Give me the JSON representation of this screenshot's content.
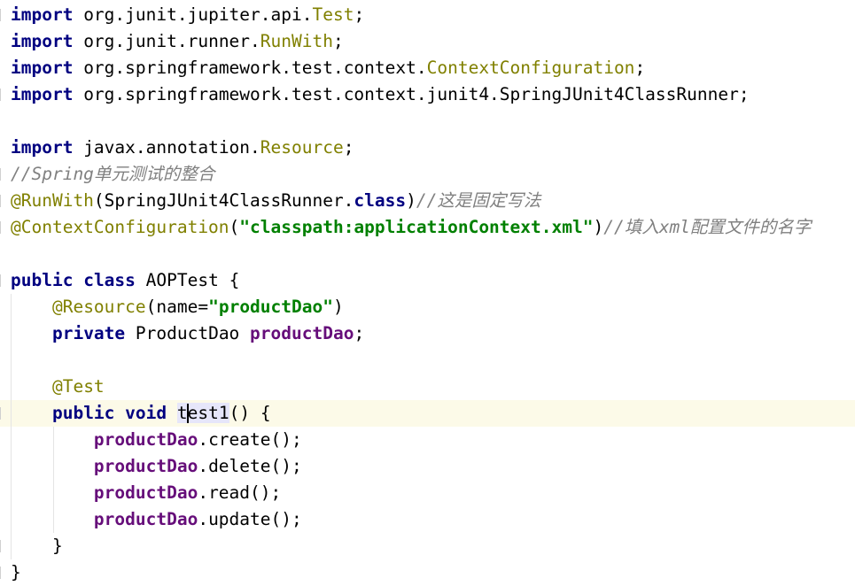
{
  "editor": {
    "lines": [
      [
        {
          "t": "import",
          "c": "kw"
        },
        {
          "t": " org.junit.jupiter.api.",
          "c": "plain"
        },
        {
          "t": "Test",
          "c": "cls-ref"
        },
        {
          "t": ";",
          "c": "plain"
        }
      ],
      [
        {
          "t": "import",
          "c": "kw"
        },
        {
          "t": " org.junit.runner.",
          "c": "plain"
        },
        {
          "t": "RunWith",
          "c": "cls-ref"
        },
        {
          "t": ";",
          "c": "plain"
        }
      ],
      [
        {
          "t": "import",
          "c": "kw"
        },
        {
          "t": " org.springframework.test.context.",
          "c": "plain"
        },
        {
          "t": "ContextConfiguration",
          "c": "cls-ref"
        },
        {
          "t": ";",
          "c": "plain"
        }
      ],
      [
        {
          "t": "import",
          "c": "kw"
        },
        {
          "t": " org.springframework.test.context.junit4.SpringJUnit4ClassRunner;",
          "c": "plain"
        }
      ],
      [],
      [
        {
          "t": "import",
          "c": "kw"
        },
        {
          "t": " javax.annotation.",
          "c": "plain"
        },
        {
          "t": "Resource",
          "c": "cls-ref"
        },
        {
          "t": ";",
          "c": "plain"
        }
      ],
      [
        {
          "t": "//Spring单元测试的整合",
          "c": "cmt"
        }
      ],
      [
        {
          "t": "@RunWith",
          "c": "ann"
        },
        {
          "t": "(SpringJUnit4ClassRunner.",
          "c": "plain"
        },
        {
          "t": "class",
          "c": "kw"
        },
        {
          "t": ")",
          "c": "plain"
        },
        {
          "t": "//这是固定写法",
          "c": "cmt"
        }
      ],
      [
        {
          "t": "@ContextConfiguration",
          "c": "ann"
        },
        {
          "t": "(",
          "c": "plain"
        },
        {
          "t": "\"classpath:applicationContext.xml\"",
          "c": "str"
        },
        {
          "t": ")",
          "c": "plain"
        },
        {
          "t": "//填入xml配置文件的名字",
          "c": "cmt"
        }
      ],
      [],
      [
        {
          "t": "public",
          "c": "kw"
        },
        {
          "t": " ",
          "c": "plain"
        },
        {
          "t": "class",
          "c": "kw"
        },
        {
          "t": " AOPTest {",
          "c": "plain"
        }
      ],
      [
        {
          "t": "    ",
          "c": "plain"
        },
        {
          "t": "@Resource",
          "c": "ann"
        },
        {
          "t": "(name=",
          "c": "plain"
        },
        {
          "t": "\"productDao\"",
          "c": "str"
        },
        {
          "t": ")",
          "c": "plain"
        }
      ],
      [
        {
          "t": "    ",
          "c": "plain"
        },
        {
          "t": "private",
          "c": "kw"
        },
        {
          "t": " ProductDao ",
          "c": "plain"
        },
        {
          "t": "productDao",
          "c": "fld"
        },
        {
          "t": ";",
          "c": "plain"
        }
      ],
      [],
      [
        {
          "t": "    ",
          "c": "plain"
        },
        {
          "t": "@Test",
          "c": "ann"
        }
      ],
      [
        {
          "t": "    ",
          "c": "plain"
        },
        {
          "t": "public",
          "c": "kw"
        },
        {
          "t": " ",
          "c": "plain"
        },
        {
          "t": "void",
          "c": "kw"
        },
        {
          "t": " ",
          "c": "plain"
        },
        {
          "t": "t",
          "c": "plain ident-hl"
        },
        {
          "caret": true
        },
        {
          "t": "est1",
          "c": "plain ident-hl"
        },
        {
          "t": "() {",
          "c": "plain"
        }
      ],
      [
        {
          "t": "        ",
          "c": "plain"
        },
        {
          "t": "productDao",
          "c": "fld"
        },
        {
          "t": ".create();",
          "c": "plain"
        }
      ],
      [
        {
          "t": "        ",
          "c": "plain"
        },
        {
          "t": "productDao",
          "c": "fld"
        },
        {
          "t": ".delete();",
          "c": "plain"
        }
      ],
      [
        {
          "t": "        ",
          "c": "plain"
        },
        {
          "t": "productDao",
          "c": "fld"
        },
        {
          "t": ".read();",
          "c": "plain"
        }
      ],
      [
        {
          "t": "        ",
          "c": "plain"
        },
        {
          "t": "productDao",
          "c": "fld"
        },
        {
          "t": ".update();",
          "c": "plain"
        }
      ],
      [
        {
          "t": "    }",
          "c": "plain"
        }
      ],
      [
        {
          "t": "}",
          "c": "plain"
        }
      ]
    ],
    "current_line": 15
  }
}
